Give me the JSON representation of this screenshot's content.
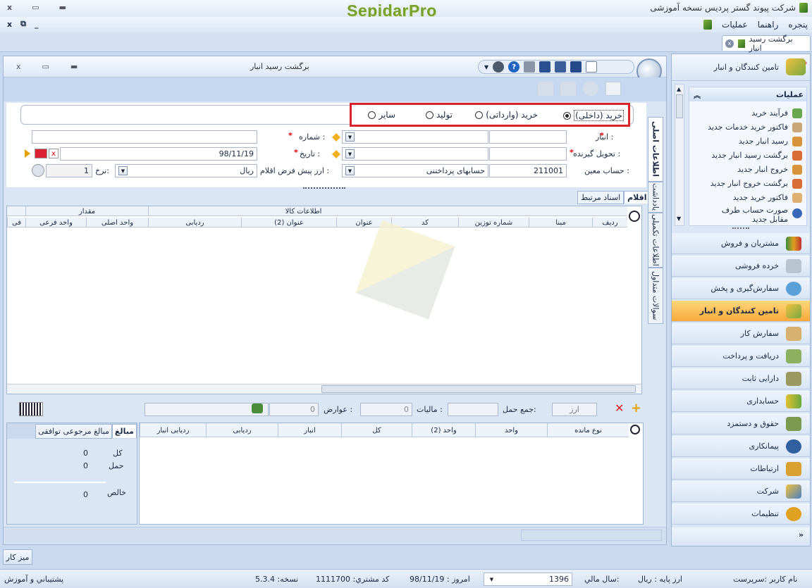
{
  "app": {
    "title": "شرکت پیوند گستر پردیس نسخه آموزشی",
    "logo_text": "SepidarPro"
  },
  "menu": {
    "items": [
      "عملیات",
      "راهنما",
      "پنجره"
    ]
  },
  "doc_tab": {
    "label": "برگشت رسید انبار"
  },
  "window": {
    "title": "برگشت رسید انبار"
  },
  "purchase_type": {
    "options": [
      "خرید (داخلی)",
      "خرید (وارداتی)",
      "تولید",
      "سایر"
    ],
    "selected": "خرید (داخلی)"
  },
  "form": {
    "warehouse_label": "انبار :",
    "receiver_label": "تحویل گیرنده :",
    "account_label": "حساب معین :",
    "account_code": "211001",
    "account_name": "حسابهای پرداختنی",
    "number_label": "شماره :",
    "date_label": "تاریخ :",
    "date_value": "98/11/19",
    "currency_label": "ارز پیش فرض اقلام :",
    "currency_value": "ریال",
    "rate_label": "نرخ:",
    "rate_value": "1"
  },
  "side_tabs": [
    "اطلاعات اصلی",
    "یادداشت",
    "اطلاعات تکمیلی",
    "سوالات متداول"
  ],
  "items_tabs": [
    "اقلام",
    "اسناد مرتبط"
  ],
  "items_grid": {
    "group_headers": [
      "اطلاعات کالا",
      "مقدار"
    ],
    "columns": [
      "ردیف",
      "مبنا",
      "شماره توزین",
      "کد",
      "عنوان",
      "عنوان (2)",
      "ردیابی",
      "واحد اصلی",
      "واحد فرعی",
      "فی"
    ]
  },
  "totals_bar": {
    "freight_label": "جمع حمل:",
    "tax_label": "مالیات :",
    "tax_value": "0",
    "duties_label": "عوارض :",
    "duties_value": "0",
    "currency_button": "ارز"
  },
  "balance_grid": {
    "columns": [
      "نوع مانده",
      "واحد",
      "واحد (2)",
      "کل",
      "انبار",
      "ردیابی",
      "ردیابی انبار"
    ]
  },
  "amounts_panel": {
    "tabs": [
      "مبالغ",
      "مبالغ مرجوعی توافقی"
    ],
    "rows": [
      {
        "label": "کل",
        "value": "0"
      },
      {
        "label": "حمل",
        "value": "0"
      },
      {
        "label": "خالص",
        "value": "0"
      }
    ]
  },
  "nav": {
    "header": "تامین کنندگان و انبار",
    "operations_title": "عملیات",
    "operations": [
      "فرآیند خرید",
      "فاکتور خرید خدمات جدید",
      "رسید انبار جدید",
      "برگشت رسید انبار جدید",
      "خروج انبار جدید",
      "برگشت خروج انبار جدید",
      "فاکتور خرید جدید",
      "صورت حساب طرف مقابل جدید"
    ],
    "modules": [
      "مشتریان و فروش",
      "خرده فروشی",
      "سفارش‌گیری و پخش",
      "تامین کنندگان و انبار",
      "سفارش کار",
      "دریافت و پرداخت",
      "دارایی ثابت",
      "حسابداری",
      "حقوق و دستمزد",
      "پیمانکاری",
      "ارتباطات",
      "شرکت",
      "تنظیمات"
    ],
    "active_module": "تامین کنندگان و انبار"
  },
  "desktop_button": "میز کار",
  "status": {
    "user": "نام کاربر :سرپرست",
    "base_currency": "ارز پایه :   ریال",
    "fiscal_year_label": "سال مالي:",
    "fiscal_year": "1396",
    "today": "امروز :   98/11/19",
    "customer_code": "كد مشتري:   1111700",
    "version": "نسخه:   5.3.4",
    "support": "پشتیباني و آموزش"
  }
}
